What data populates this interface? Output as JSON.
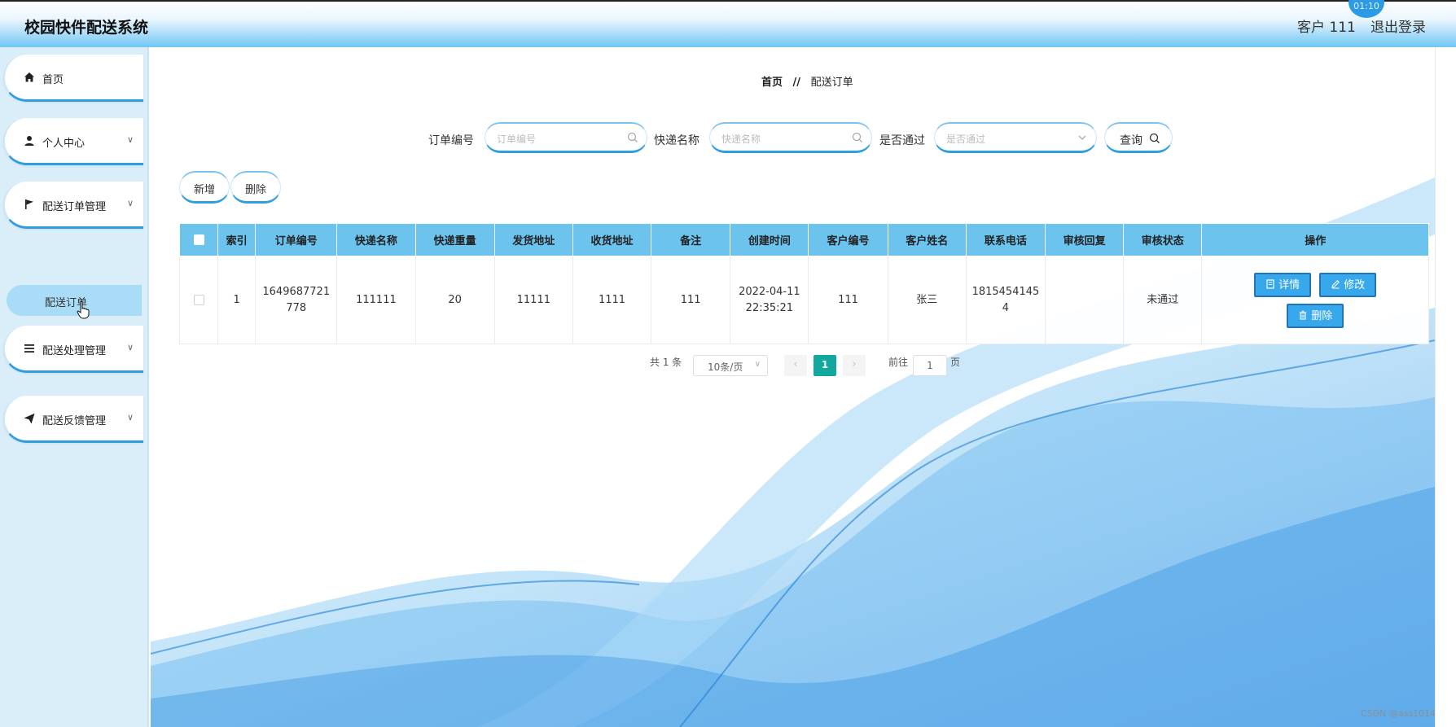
{
  "header": {
    "app_title": "校园快件配送系统",
    "user_label": "客户 111",
    "logout_label": "退出登录",
    "clock_badge": "01:10"
  },
  "sidebar": {
    "items": [
      {
        "label": "首页",
        "icon": "home-icon"
      },
      {
        "label": "个人中心",
        "icon": "user-icon"
      },
      {
        "label": "配送订单管理",
        "icon": "flag-icon"
      },
      {
        "label": "配送处理管理",
        "icon": "list-icon"
      },
      {
        "label": "配送反馈管理",
        "icon": "send-icon"
      }
    ],
    "active_subitem": "配送订单"
  },
  "breadcrumb": {
    "home": "首页",
    "separator": "//",
    "current": "配送订单"
  },
  "search": {
    "order_no_label": "订单编号",
    "order_no_placeholder": "订单编号",
    "express_name_label": "快递名称",
    "express_name_placeholder": "快递名称",
    "approved_label": "是否通过",
    "approved_placeholder": "是否通过",
    "query_button": "查询"
  },
  "toolbar": {
    "add_label": "新增",
    "delete_label": "删除"
  },
  "table": {
    "columns": [
      "索引",
      "订单编号",
      "快递名称",
      "快递重量",
      "发货地址",
      "收货地址",
      "备注",
      "创建时间",
      "客户编号",
      "客户姓名",
      "联系电话",
      "审核回复",
      "审核状态",
      "操作"
    ],
    "rows": [
      {
        "index": "1",
        "order_no": "1649687721778",
        "express_name": "111111",
        "weight": "20",
        "ship_addr": "11111",
        "recv_addr": "1111",
        "remark": "111",
        "created": "2022-04-11 22:35:21",
        "customer_no": "111",
        "customer_name": "张三",
        "phone": "18154541454",
        "review_reply": "",
        "review_status": "未通过",
        "actions": {
          "detail": "详情",
          "edit": "修改",
          "delete": "删除"
        }
      }
    ]
  },
  "pagination": {
    "total_text": "共 1 条",
    "page_size": "10条/页",
    "current_page": "1",
    "goto_label": "前往",
    "goto_value": "1",
    "page_unit": "页"
  },
  "watermark": "CSDN @ass1014",
  "colors": {
    "accent": "#2f9de0",
    "table_header": "#6cc3ee",
    "action_button": "#38a8ec",
    "page_active": "#13a89e",
    "sidebar_bg": "#d9eef9"
  }
}
